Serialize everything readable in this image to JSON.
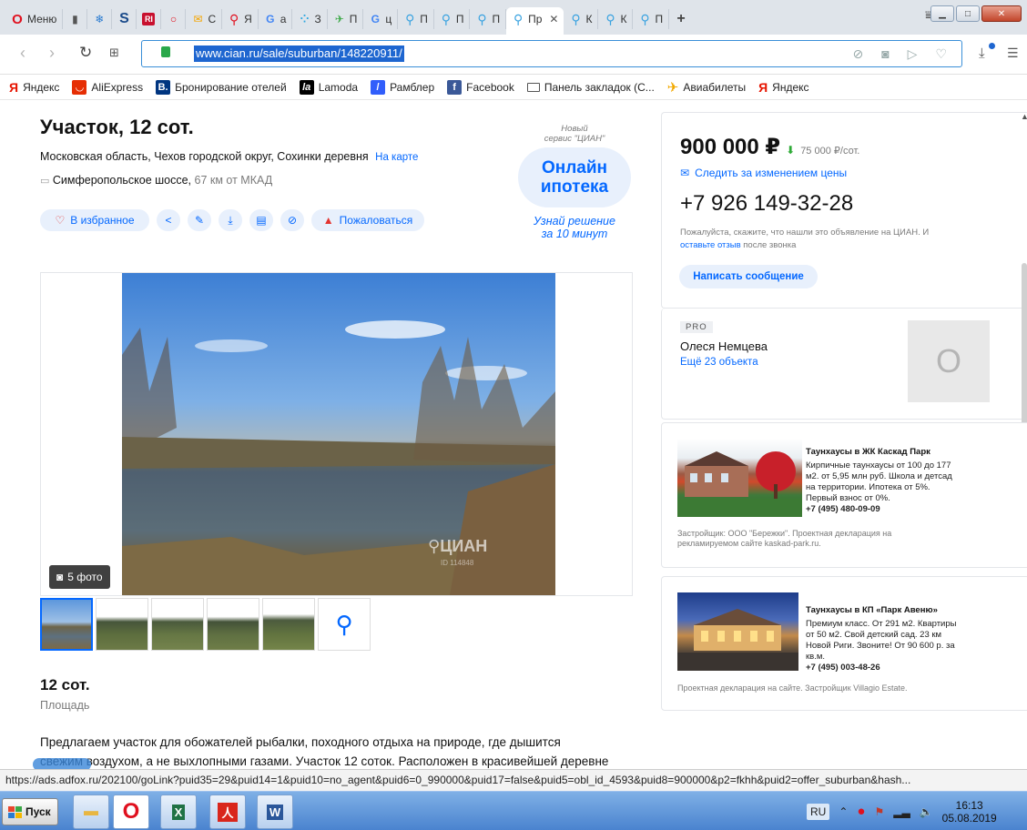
{
  "browser": {
    "tabs": [
      {
        "label": "Меню",
        "icon": "opera-icon"
      },
      {
        "label": "",
        "icon": "file-icon"
      },
      {
        "label": "",
        "icon": "snowflake-icon"
      },
      {
        "label": "",
        "icon": "s-icon"
      },
      {
        "label": "",
        "icon": "ria-icon"
      },
      {
        "label": "",
        "icon": "opera-icon"
      },
      {
        "label": "С",
        "icon": "mail-icon"
      },
      {
        "label": "Я",
        "icon": "pin-icon"
      },
      {
        "label": "a",
        "icon": "google-icon"
      },
      {
        "label": "З",
        "icon": "dots-icon"
      },
      {
        "label": "П",
        "icon": "bird-icon"
      },
      {
        "label": "ц",
        "icon": "google-icon"
      },
      {
        "label": "П",
        "icon": "pin-icon"
      },
      {
        "label": "П",
        "icon": "pin-icon"
      },
      {
        "label": "П",
        "icon": "pin-icon"
      },
      {
        "label": "Пр",
        "icon": "pin-icon",
        "active": true
      },
      {
        "label": "К",
        "icon": "pin-icon"
      },
      {
        "label": "К",
        "icon": "pin-icon"
      },
      {
        "label": "П",
        "icon": "pin-icon"
      }
    ],
    "url": "www.cian.ru/sale/suburban/148220911/",
    "bookmarks": [
      {
        "label": "Яндекс",
        "icon": "yandex-icon",
        "color": "#e61400"
      },
      {
        "label": "AliExpress",
        "icon": "aliexpress-icon",
        "color": "#e62e04"
      },
      {
        "label": "Бронирование отелей",
        "icon": "booking-icon",
        "color": "#003580"
      },
      {
        "label": "Lamoda",
        "icon": "lamoda-icon",
        "color": "#000000"
      },
      {
        "label": "Рамблер",
        "icon": "rambler-icon",
        "color": "#315efb"
      },
      {
        "label": "Facebook",
        "icon": "facebook-icon",
        "color": "#3b5998"
      },
      {
        "label": "Панель закладок (С...",
        "icon": "folder-icon",
        "color": "#555555"
      },
      {
        "label": "Авиабилеты",
        "icon": "plane-icon",
        "color": "#f2a900"
      },
      {
        "label": "Яндекс",
        "icon": "yandex-icon",
        "color": "#e61400"
      }
    ]
  },
  "listing": {
    "title": "Участок, 12 сот.",
    "address": "Московская область, Чехов городской округ, Сохинки деревня",
    "map_link": "На карте",
    "highway": "Симферопольское шоссе,",
    "distance": "67 км от МКАД",
    "favorite": "В избранное",
    "complain": "Пожаловаться",
    "photos_count": "5 фото",
    "watermark": "ЦИАН",
    "watermark_id": "ID 114848",
    "area_value": "12 сот.",
    "area_label": "Площадь",
    "description_1": "Предлагаем участок для обожателей рыбалки, походного отдыха на природе, где дышится",
    "description_2": "свежим воздухом, а не выхлопными газами. Участок 12 соток. Расположен в красивейшей деревне"
  },
  "promo": {
    "new_service_1": "Новый",
    "new_service_2": "сервис \"ЦИАН\"",
    "title_1": "Онлайн",
    "title_2": "ипотека",
    "cta_1": "Узнай решение",
    "cta_2": "за 10 минут"
  },
  "contact": {
    "price": "900 000 ₽",
    "price_per": "75 000 ₽/сот.",
    "follow_price": "Следить за изменением цены",
    "phone": "+7 926 149-32-28",
    "note_1": "Пожалуйста, скажите, что нашли это объявление на ЦИАН. И",
    "note_link": "оставьте отзыв",
    "note_2": "после звонка",
    "message_button": "Написать сообщение",
    "agent_badge": "PRO",
    "agent_name": "Олеся Немцева",
    "agent_more": "Ещё 23 объекта",
    "agent_initial": "О"
  },
  "ads": [
    {
      "title": "Таунхаусы в ЖК Каскад Парк",
      "text": [
        "Кирпичные таунхаусы от 100 до 177",
        "м2. от 5,95 млн руб. Школа и детсад",
        "на территории. Ипотека от 5%.",
        "Первый взнос от 0%."
      ],
      "phone": "+7 (495) 480-09-09",
      "note": [
        "Застройщик: ООО \"Бережки\". Проектная декларация на",
        "рекламируемом сайте kaskad-park.ru."
      ]
    },
    {
      "title": "Таунхаусы в КП «Парк Авеню»",
      "text": [
        "Премиум класс. От 291 м2. Квартиры",
        "от 50 м2. Свой детский сад. 23 км",
        "Новой Риги. Звоните! От 90 600 р. за",
        "кв.м."
      ],
      "phone": "+7 (495) 003-48-26",
      "note": [
        "Проектная декларация на сайте. Застройщик Villagio Estate."
      ]
    }
  ],
  "status_url": "https://ads.adfox.ru/202100/goLink?puid35=29&puid14=1&puid10=no_agent&puid6=0_990000&puid17=false&puid5=obl_id_4593&puid8=900000&p2=fkhh&puid2=offer_suburban&hash...",
  "taskbar": {
    "start": "Пуск",
    "lang": "RU",
    "time": "16:13",
    "date": "05.08.2019"
  },
  "colors": {
    "accent": "#0468ff",
    "price_down": "#2eaa36",
    "complain": "#e3342f"
  }
}
